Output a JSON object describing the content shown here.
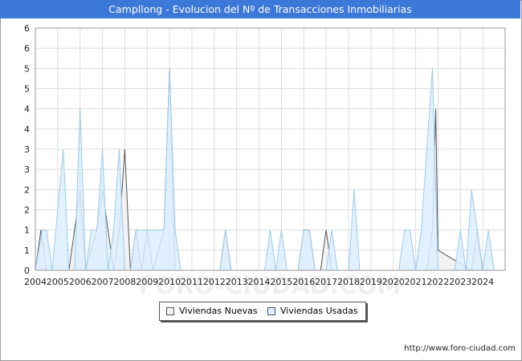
{
  "title": "Campllong - Evolucion del Nº de Transacciones Inmobiliarias",
  "source_text": "http://www.foro-ciudad.com",
  "watermark": "FORO-CIUDAD.COM",
  "colors": {
    "title_bg": "#3c78d8",
    "nuevas_fill": "#f2f2f2",
    "nuevas_line": "#555555",
    "usadas_fill": "#ddeeff",
    "usadas_line": "#99ccee"
  },
  "legend": {
    "nuevas": "Viviendas Nuevas",
    "usadas": "Viviendas Usadas"
  },
  "chart_data": {
    "type": "area",
    "ylim": [
      0,
      6
    ],
    "xlim": [
      2004,
      2025
    ],
    "y_ticks": [
      "0",
      "1",
      "1",
      "2",
      "2",
      "3",
      "3",
      "4",
      "4",
      "5",
      "5",
      "6"
    ],
    "y_tick_values": [
      0,
      0.5,
      1,
      1.5,
      2,
      2.5,
      3,
      3.5,
      4,
      4.5,
      5,
      5.5
    ],
    "x_ticks": [
      "2004",
      "2005",
      "2006",
      "2007",
      "2008",
      "2009",
      "2010",
      "2011",
      "2012",
      "2013",
      "2014",
      "2015",
      "2016",
      "2017",
      "2018",
      "2019",
      "2020",
      "2021",
      "2022",
      "2023",
      "2024"
    ],
    "grid": true,
    "legend_position": "bottom",
    "series": [
      {
        "name": "Viviendas Nuevas",
        "points": [
          [
            2004,
            0
          ],
          [
            2004.25,
            1
          ],
          [
            2004.5,
            0
          ],
          [
            2005.5,
            0
          ],
          [
            2005.75,
            1
          ],
          [
            2006,
            2
          ],
          [
            2006.25,
            0
          ],
          [
            2006.75,
            1
          ],
          [
            2007,
            2
          ],
          [
            2007.25,
            1
          ],
          [
            2007.5,
            0
          ],
          [
            2007.75,
            1
          ],
          [
            2008,
            3
          ],
          [
            2008.25,
            0
          ],
          [
            2008.5,
            1
          ],
          [
            2008.75,
            0
          ],
          [
            2009,
            1
          ],
          [
            2009.25,
            0
          ],
          [
            2009.75,
            1
          ],
          [
            2010,
            5
          ],
          [
            2010.25,
            0
          ],
          [
            2012.25,
            0
          ],
          [
            2012.5,
            1
          ],
          [
            2012.75,
            0
          ],
          [
            2015.75,
            0
          ],
          [
            2016,
            1
          ],
          [
            2016.25,
            1
          ],
          [
            2016.5,
            0
          ],
          [
            2016.75,
            0
          ],
          [
            2017,
            1
          ],
          [
            2017.25,
            0
          ],
          [
            2021.5,
            0
          ],
          [
            2021.75,
            1
          ],
          [
            2021.9,
            4
          ],
          [
            2022,
            0.5
          ],
          [
            2023.5,
            0
          ],
          [
            2023.75,
            1
          ],
          [
            2024,
            0
          ]
        ]
      },
      {
        "name": "Viviendas Usadas",
        "points": [
          [
            2004,
            0
          ],
          [
            2004.3,
            1
          ],
          [
            2004.5,
            1
          ],
          [
            2004.75,
            0
          ],
          [
            2005.25,
            3
          ],
          [
            2005.5,
            0
          ],
          [
            2005.75,
            0
          ],
          [
            2006,
            4
          ],
          [
            2006.25,
            0
          ],
          [
            2006.5,
            1
          ],
          [
            2006.75,
            1
          ],
          [
            2007,
            3
          ],
          [
            2007.25,
            0
          ],
          [
            2007.5,
            1
          ],
          [
            2007.75,
            3
          ],
          [
            2008,
            0
          ],
          [
            2008.25,
            0
          ],
          [
            2008.5,
            1
          ],
          [
            2008.75,
            1
          ],
          [
            2009,
            1
          ],
          [
            2009.25,
            1
          ],
          [
            2009.5,
            1
          ],
          [
            2009.75,
            1
          ],
          [
            2010,
            5
          ],
          [
            2010.25,
            1
          ],
          [
            2010.5,
            0
          ],
          [
            2012.25,
            0
          ],
          [
            2012.5,
            1
          ],
          [
            2012.75,
            0
          ],
          [
            2014.25,
            0
          ],
          [
            2014.5,
            1
          ],
          [
            2014.75,
            0
          ],
          [
            2015,
            1
          ],
          [
            2015.25,
            0
          ],
          [
            2015.75,
            0
          ],
          [
            2016,
            1
          ],
          [
            2016.25,
            1
          ],
          [
            2016.5,
            0
          ],
          [
            2017,
            0
          ],
          [
            2017.25,
            1
          ],
          [
            2017.5,
            0
          ],
          [
            2018,
            0
          ],
          [
            2018.25,
            2
          ],
          [
            2018.5,
            0
          ],
          [
            2020.25,
            0
          ],
          [
            2020.5,
            1
          ],
          [
            2020.75,
            1
          ],
          [
            2021,
            0
          ],
          [
            2021.25,
            1
          ],
          [
            2021.5,
            3
          ],
          [
            2021.75,
            5
          ],
          [
            2022,
            0
          ],
          [
            2022.75,
            0
          ],
          [
            2023,
            1
          ],
          [
            2023.25,
            0
          ],
          [
            2023.5,
            2
          ],
          [
            2023.75,
            1
          ],
          [
            2024,
            0
          ],
          [
            2024.25,
            1
          ],
          [
            2024.5,
            0
          ]
        ]
      }
    ]
  }
}
